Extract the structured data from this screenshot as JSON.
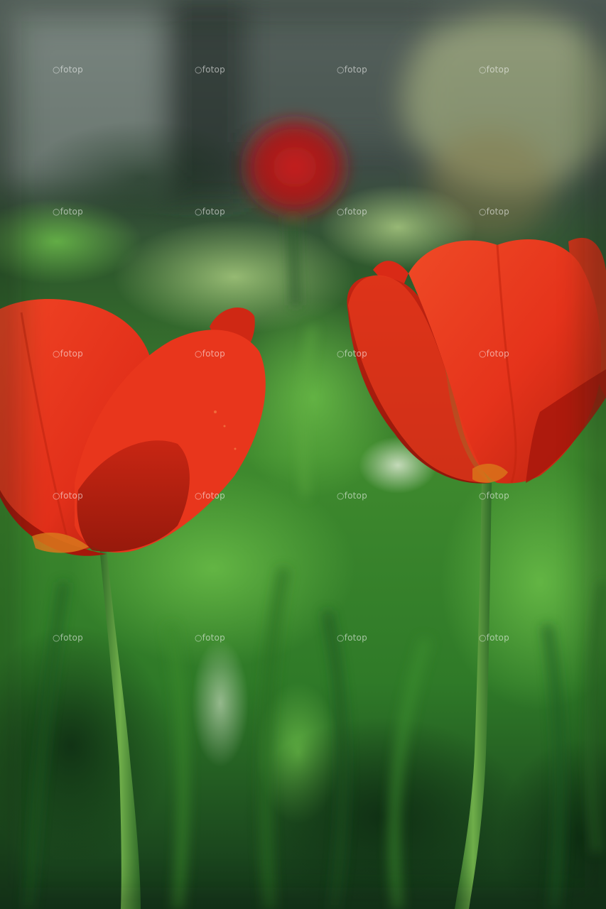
{
  "image": {
    "subject": "red tulips",
    "palette": {
      "petal_red": "#e8321a",
      "petal_dark": "#b01a0c",
      "grass_green": "#3f9a2e",
      "grass_dark": "#12361a",
      "background_gray": "#5d6866"
    }
  },
  "watermark": {
    "text": "fotop"
  }
}
